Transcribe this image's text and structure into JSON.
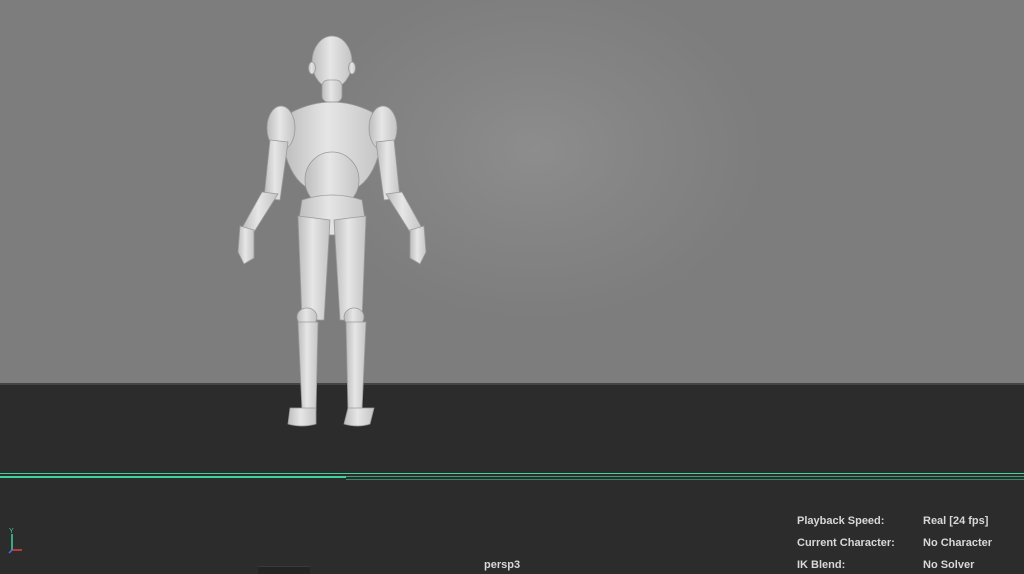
{
  "viewport": {
    "camera_name": "persp3",
    "axis_label": "Y"
  },
  "hud": {
    "playback_speed": {
      "label": "Playback Speed:",
      "value": "Real [24 fps]"
    },
    "current_character": {
      "label": "Current Character:",
      "value": "No Character"
    },
    "ik_blend": {
      "label": "IK Blend:",
      "value": "No Solver"
    }
  },
  "colors": {
    "background_gradient": "#858585",
    "floor": "#2c2c2c",
    "timeline_accent": "#3fd39a",
    "hud_text": "#d8d8d8"
  }
}
